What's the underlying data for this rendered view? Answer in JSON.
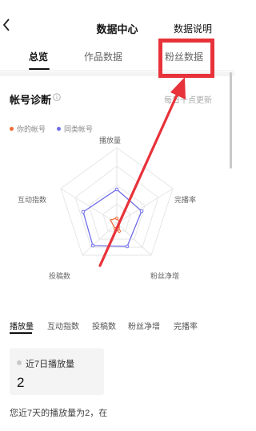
{
  "header": {
    "back_icon": "chevron-left-icon",
    "title": "数据中心",
    "explain_label": "数据说明"
  },
  "tabs": [
    {
      "label": "总览",
      "active": true
    },
    {
      "label": "作品数据",
      "active": false
    },
    {
      "label": "粉丝数据",
      "active": false
    }
  ],
  "diagnosis": {
    "title": "帐号诊断",
    "info_icon": "info-icon",
    "update_note": "每日十点更新"
  },
  "legend": [
    {
      "label": "你的帐号",
      "color": "#f26b3a"
    },
    {
      "label": "同类帐号",
      "color": "#6f6de9"
    }
  ],
  "radar_axes": [
    "播放量",
    "完播率",
    "粉丝净增",
    "投稿数",
    "互动指数"
  ],
  "metric_tabs": [
    "播放量",
    "互动指数",
    "投稿数",
    "粉丝净增",
    "完播率"
  ],
  "card": {
    "label": "近7日播放量",
    "value": "2"
  },
  "bottom_text": "您近7天的播放量为2，在",
  "colors": {
    "annotation_red": "#e8323a",
    "your_account": "#f26b3a",
    "peer_account": "#6f6de9"
  }
}
